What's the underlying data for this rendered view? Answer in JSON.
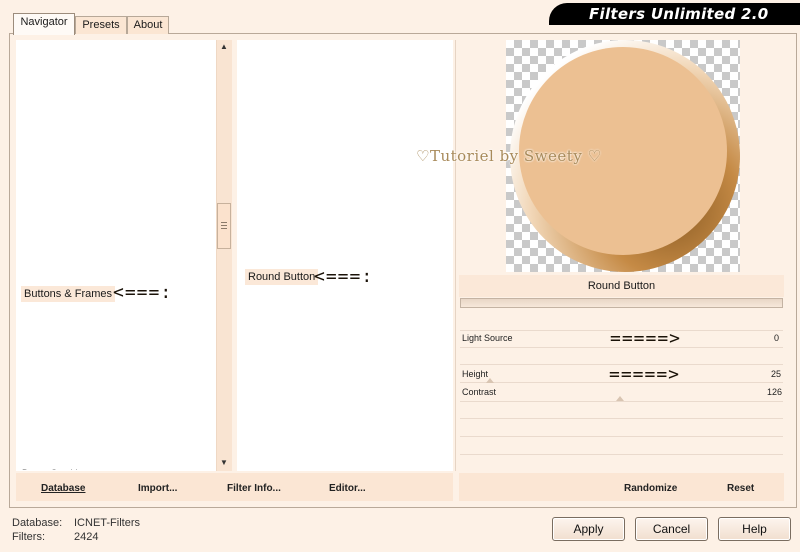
{
  "app": {
    "title": "Filters Unlimited 2.0"
  },
  "tabs": [
    {
      "label": "Navigator",
      "active": true
    },
    {
      "label": "Presets",
      "active": false
    },
    {
      "label": "About",
      "active": false
    }
  ],
  "navigator": {
    "category_selected": "Buttons & Frames",
    "category_partial_below": "Button Graphics",
    "filter_selected": "Round Button",
    "arrow_category": "<===:",
    "arrow_filter": "<===:"
  },
  "preview": {
    "watermark": "♡Tutoriel by Sweety ♡",
    "filter_name": "Round Button"
  },
  "parameters": [
    {
      "label": "Light Source",
      "value": "0",
      "arrow": "=====>",
      "level": 0
    },
    {
      "label": "Height",
      "value": "25",
      "arrow": "=====>",
      "level": 25
    },
    {
      "label": "Contrast",
      "value": "126",
      "arrow": "",
      "level": 126
    }
  ],
  "toolbar": {
    "database": "Database",
    "import": "Import...",
    "filter_info": "Filter Info...",
    "editor": "Editor...",
    "randomize": "Randomize",
    "reset": "Reset"
  },
  "status": {
    "database_label": "Database:",
    "database_value": "ICNET-Filters",
    "filters_label": "Filters:",
    "filters_value": "2424"
  },
  "buttons": {
    "apply": "Apply",
    "cancel": "Cancel",
    "help": "Help"
  },
  "colors": {
    "background": "#fdf1e6",
    "panel": "#ffffff",
    "accent": "#ecc092",
    "banner": "#000000"
  }
}
